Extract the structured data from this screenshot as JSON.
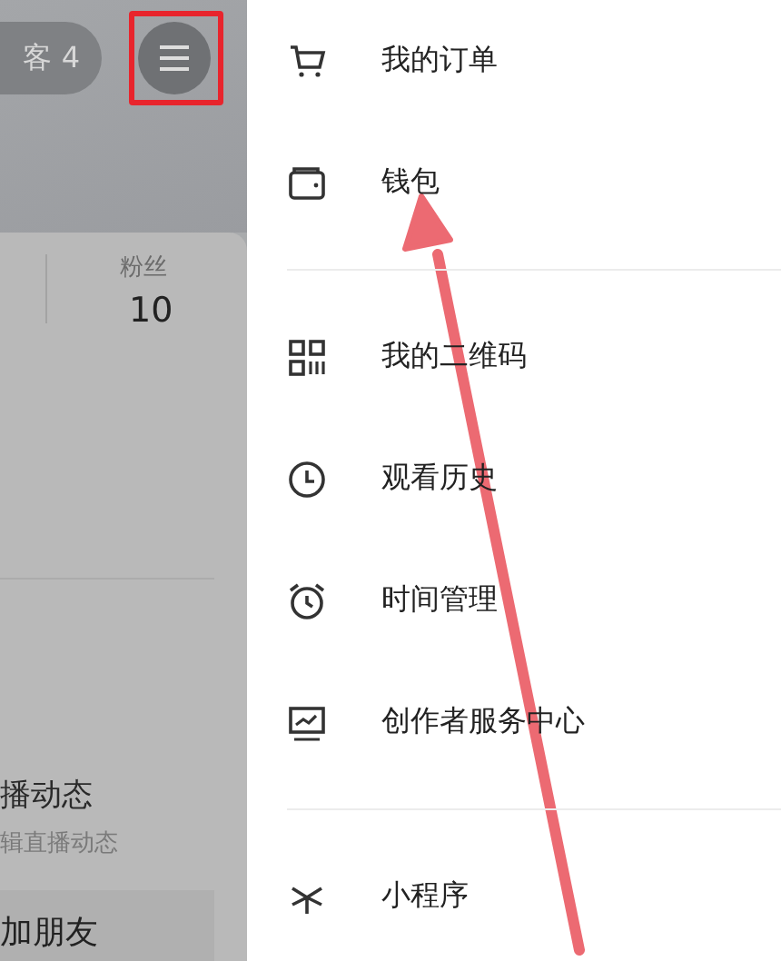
{
  "profile": {
    "visitor_chip": "客 4",
    "followers_label": "粉丝",
    "followers_count": "10",
    "live_title": "播动态",
    "live_subtitle": "辑直播动态",
    "add_friend": "加朋友"
  },
  "menu_groups": [
    [
      {
        "label": "我的订单"
      },
      {
        "label": "钱包"
      }
    ],
    [
      {
        "label": "我的二维码"
      },
      {
        "label": "观看历史"
      },
      {
        "label": "时间管理"
      },
      {
        "label": "创作者服务中心"
      }
    ],
    [
      {
        "label": "小程序"
      }
    ]
  ],
  "annotations": {
    "menu_button_highlight": true,
    "arrow_to_item": true
  }
}
